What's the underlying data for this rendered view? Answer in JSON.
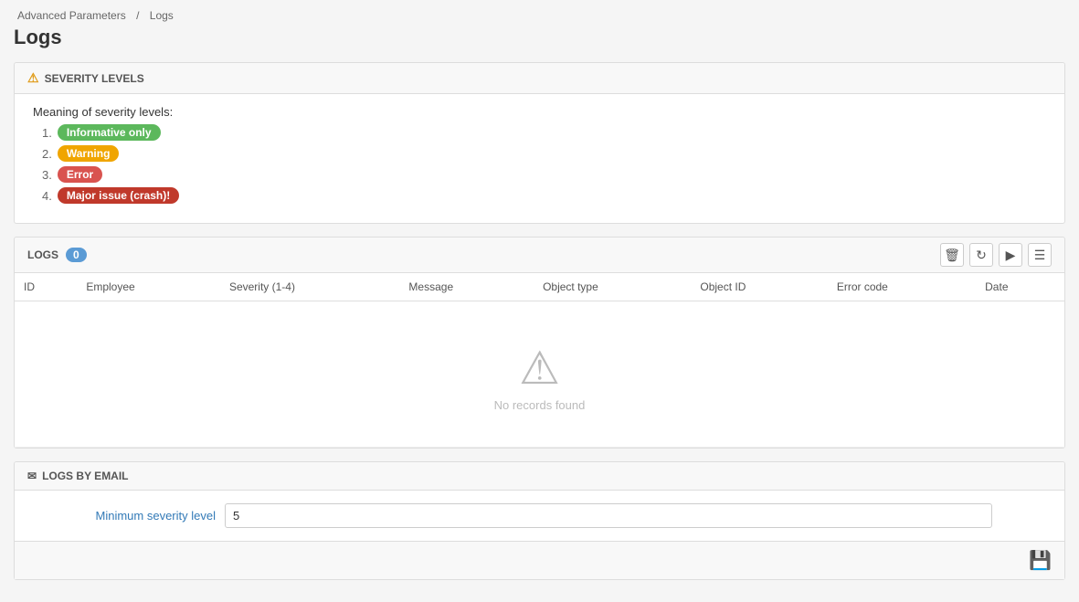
{
  "breadcrumb": {
    "parent": "Advanced Parameters",
    "separator": "/",
    "current": "Logs"
  },
  "page": {
    "title": "Logs"
  },
  "severity_panel": {
    "header_icon": "⚠",
    "header_label": "SEVERITY LEVELS",
    "intro": "Meaning of severity levels:",
    "levels": [
      {
        "num": "1.",
        "label": "Informative only",
        "badge_class": "badge-green"
      },
      {
        "num": "2.",
        "label": "Warning",
        "badge_class": "badge-orange"
      },
      {
        "num": "3.",
        "label": "Error",
        "badge_class": "badge-red"
      },
      {
        "num": "4.",
        "label": "Major issue (crash)!",
        "badge_class": "badge-darkred"
      }
    ]
  },
  "logs_panel": {
    "header_label": "LOGS",
    "count": "0",
    "columns": [
      "ID",
      "Employee",
      "Severity (1-4)",
      "Message",
      "Object type",
      "Object ID",
      "Error code",
      "Date"
    ],
    "no_records_text": "No records found",
    "icons": {
      "delete": "🗑",
      "refresh": "↻",
      "terminal": "▶",
      "menu": "☰"
    }
  },
  "email_panel": {
    "header_icon": "✉",
    "header_label": "LOGS BY EMAIL",
    "form": {
      "label": "Minimum severity level",
      "value": "5",
      "placeholder": ""
    }
  },
  "bottom_bar": {
    "save_icon": "💾"
  }
}
